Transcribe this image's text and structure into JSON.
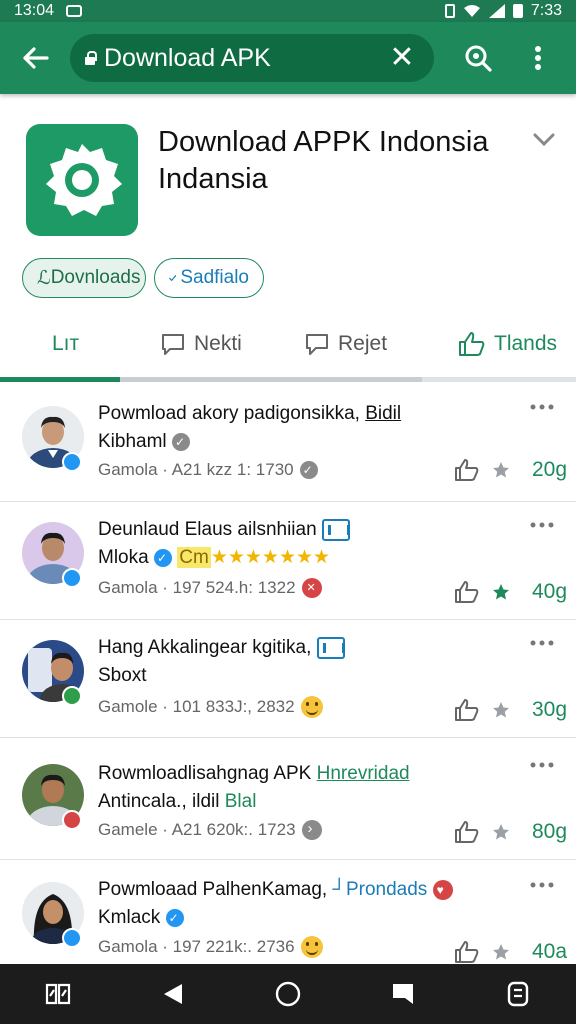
{
  "status_bar": {
    "time_left": "13:04",
    "time_right": "7:33"
  },
  "app_bar": {
    "search_text": "Download APK",
    "clear_icon": "close-icon"
  },
  "header": {
    "title": "Download APPK Indonsia Indansia",
    "chips": [
      {
        "label": "Dovnloads",
        "prefix": "ℒ"
      },
      {
        "label": "Sadfialo",
        "icon": "check-icon"
      }
    ]
  },
  "tabs": [
    {
      "label": "Lıт"
    },
    {
      "label": "Nekti",
      "icon": "comment-icon"
    },
    {
      "label": "Rejet",
      "icon": "chat-icon"
    },
    {
      "label": "Tlands",
      "icon": "thumbs-up-icon"
    }
  ],
  "items": [
    {
      "title_a": "Powmload akory padigonsikka, ",
      "title_b": "Bidil",
      "subtitle": "Kibhaml",
      "meta": "Gamola · A21 kzz 1: 1730",
      "count": "20g",
      "colors": {
        "skin": "#c89a7a",
        "shirt": "#2c4a7a",
        "bg": "#e8ecef",
        "badge": "#2196f3"
      }
    },
    {
      "title": "Deunlaud Elaus ailsnhiian",
      "subtitle": "Mloka",
      "highlight": "Cm",
      "meta": "Gamola · 197 524.h: 1322",
      "count": "40g",
      "colors": {
        "skin": "#b98a6a",
        "shirt": "#6a8ab8",
        "bg": "#d9c8ea",
        "badge": "#2196f3"
      }
    },
    {
      "title": "Hang Akkalingear kgitika, ",
      "subtitle": "Sboxt",
      "meta": "Gamole · 101 833J:, 2832",
      "count": "30g",
      "colors": {
        "skin": "#c48d6a",
        "shirt": "#3a3a3a",
        "bg": "#2a4a88",
        "badge": "#2e9e4a"
      }
    },
    {
      "title_a": "Rowmloadlisahgnag APK ",
      "title_b": "Hnrevridad",
      "subtitle_a": "Antincala., ildil ",
      "subtitle_b": "Blal",
      "meta": "Gamele · A21 620k:. 1723",
      "count": "80g",
      "colors": {
        "skin": "#b07a55",
        "shirt": "#d0d6dc",
        "bg": "#5a7a4a",
        "badge": "#d64545"
      }
    },
    {
      "title_a": "Powmloaad PalhenKamag, ",
      "title_b": "Prondads",
      "subtitle": "Kmlack",
      "meta": "Gamola · 197 221k:. 2736",
      "count": "40a",
      "colors": {
        "skin": "#c4906a",
        "shirt": "#1e2a44",
        "bg": "#e8ecef",
        "badge": "#2196f3"
      }
    }
  ],
  "colors": {
    "primary": "#1e8a5c",
    "primary_dark": "#0f6b42",
    "accent_blue": "#1a7db8"
  }
}
